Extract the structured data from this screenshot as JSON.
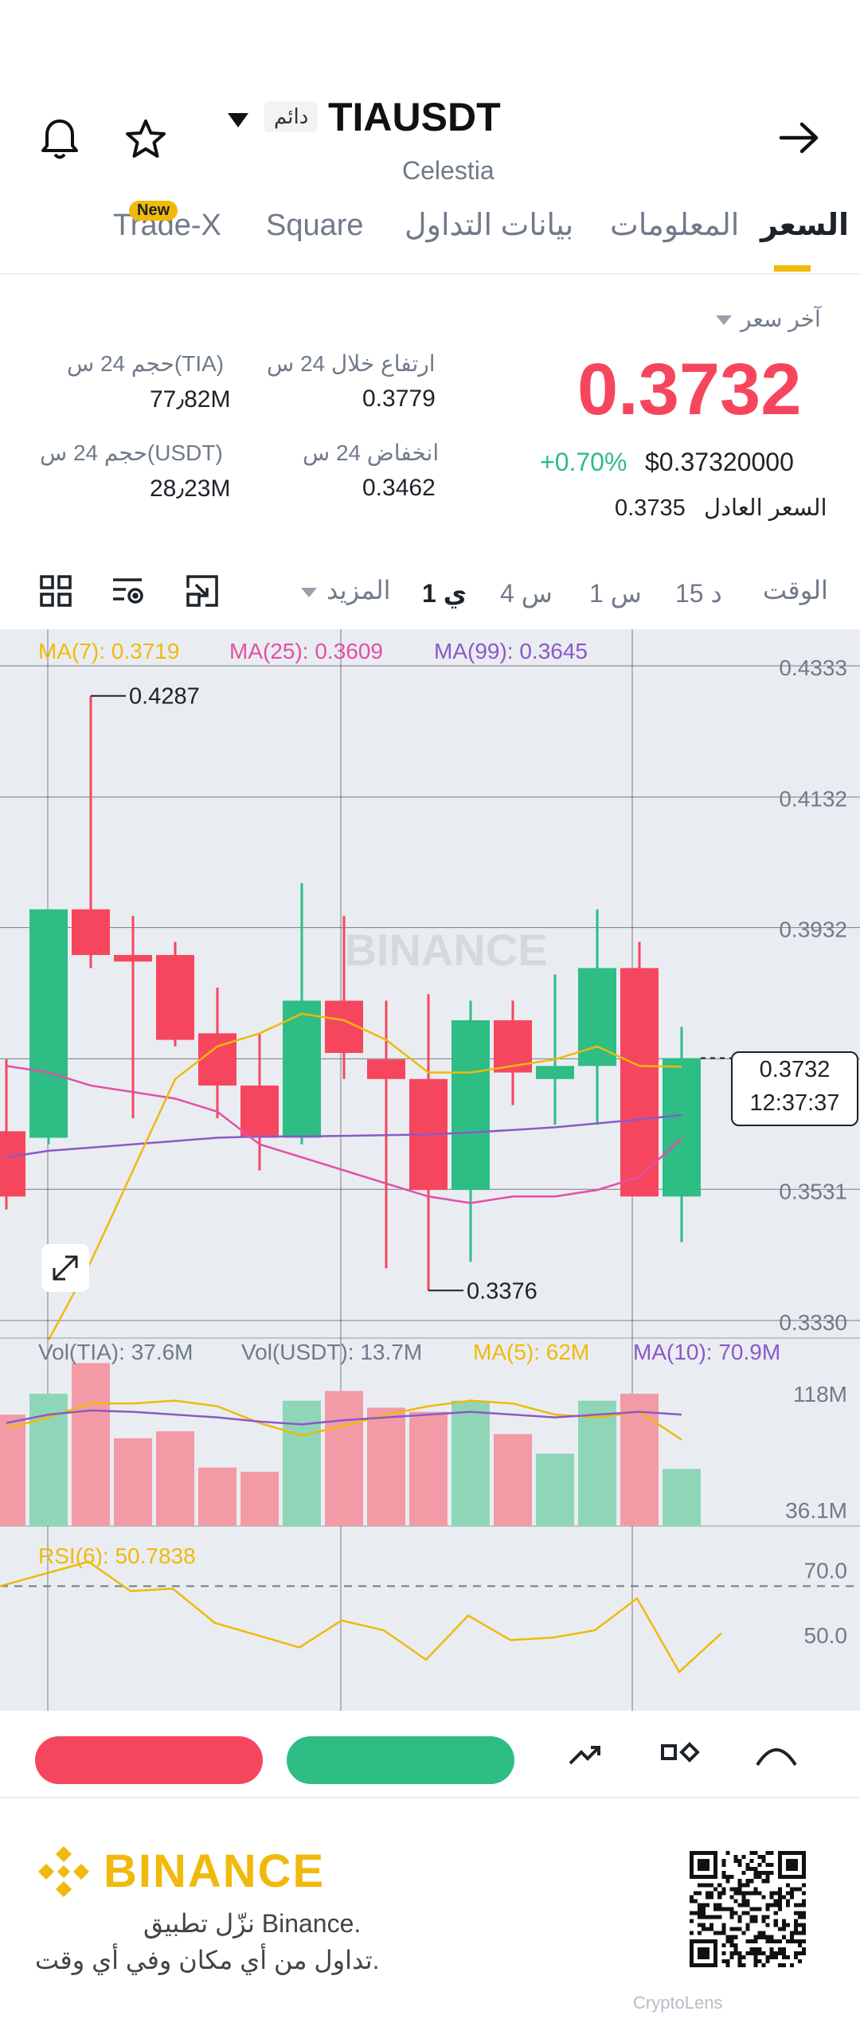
{
  "header": {
    "symbol": "TIAUSDT",
    "perpetual_badge": "دائم",
    "name": "Celestia"
  },
  "tabs": [
    {
      "label": "السعر",
      "active": true
    },
    {
      "label": "المعلومات"
    },
    {
      "label": "بيانات التداول"
    },
    {
      "label": "Square"
    },
    {
      "label": "Trade-X",
      "badge": "New"
    }
  ],
  "price": {
    "type_label": "آخر سعر",
    "last": "0.3732",
    "change": "+0.70%",
    "usd": "$0.37320000",
    "fair_label": "السعر العادل",
    "fair_value": "0.3735"
  },
  "stats": {
    "high_label": "ارتفاع خلال 24 س",
    "high_value": "0.3779",
    "low_label": "انخفاض 24 س",
    "low_value": "0.3462",
    "vol_tia_label": "حجم 24 س(TIA)",
    "vol_tia_value": "77٫82M",
    "vol_usdt_label": "حجم 24 س(USDT)",
    "vol_usdt_value": "28٫23M"
  },
  "timeframes": {
    "time_label": "الوقت",
    "items": [
      "15 د",
      "1 س",
      "4 س",
      "1 ي"
    ],
    "active": "1 ي",
    "more": "المزيد"
  },
  "indicators": {
    "ma7": "MA(7): 0.3719",
    "ma25": "MA(25): 0.3609",
    "ma99": "MA(99): 0.3645",
    "vol_tia": "Vol(TIA): 37.6M",
    "vol_usdt": "Vol(USDT): 13.7M",
    "ma5": "MA(5): 62M",
    "ma10": "MA(10): 70.9M",
    "rsi": "RSI(6): 50.7838"
  },
  "chart_data": {
    "type": "candlestick",
    "price_axis": [
      "0.4333",
      "0.4132",
      "0.3932",
      "0.3731",
      "0.3531",
      "0.3330"
    ],
    "price_ylim": [
      0.333,
      0.4333
    ],
    "high_annotation": "0.4287",
    "low_annotation": "0.3376",
    "current_price": "0.3732",
    "countdown": "12:37:37",
    "candles": [
      {
        "o": 0.362,
        "h": 0.373,
        "l": 0.35,
        "c": 0.352
      },
      {
        "o": 0.361,
        "h": 0.396,
        "l": 0.36,
        "c": 0.396
      },
      {
        "o": 0.396,
        "h": 0.4287,
        "l": 0.387,
        "c": 0.389
      },
      {
        "o": 0.389,
        "h": 0.395,
        "l": 0.364,
        "c": 0.388
      },
      {
        "o": 0.389,
        "h": 0.391,
        "l": 0.375,
        "c": 0.376
      },
      {
        "o": 0.377,
        "h": 0.384,
        "l": 0.364,
        "c": 0.369
      },
      {
        "o": 0.369,
        "h": 0.377,
        "l": 0.356,
        "c": 0.361
      },
      {
        "o": 0.361,
        "h": 0.4,
        "l": 0.36,
        "c": 0.382
      },
      {
        "o": 0.382,
        "h": 0.395,
        "l": 0.37,
        "c": 0.374
      },
      {
        "o": 0.373,
        "h": 0.382,
        "l": 0.341,
        "c": 0.37
      },
      {
        "o": 0.37,
        "h": 0.383,
        "l": 0.3376,
        "c": 0.353
      },
      {
        "o": 0.353,
        "h": 0.382,
        "l": 0.342,
        "c": 0.379
      },
      {
        "o": 0.379,
        "h": 0.382,
        "l": 0.366,
        "c": 0.371
      },
      {
        "o": 0.37,
        "h": 0.386,
        "l": 0.363,
        "c": 0.372
      },
      {
        "o": 0.372,
        "h": 0.396,
        "l": 0.363,
        "c": 0.387
      },
      {
        "o": 0.387,
        "h": 0.391,
        "l": 0.352,
        "c": 0.352
      },
      {
        "o": 0.352,
        "h": 0.378,
        "l": 0.345,
        "c": 0.3732
      }
    ],
    "ma7": [
      null,
      0.33,
      0.342,
      0.356,
      0.37,
      0.375,
      0.377,
      0.38,
      0.379,
      0.376,
      0.371,
      0.371,
      0.372,
      0.373,
      0.375,
      0.372,
      0.3719
    ],
    "ma25": [
      0.372,
      0.371,
      0.369,
      0.368,
      0.367,
      0.365,
      0.36,
      0.358,
      0.356,
      0.354,
      0.352,
      0.351,
      0.352,
      0.352,
      0.353,
      0.355,
      0.3609
    ],
    "ma99": [
      0.358,
      0.359,
      0.3595,
      0.36,
      0.3605,
      0.361,
      0.3612,
      0.3612,
      0.3613,
      0.3614,
      0.3615,
      0.3618,
      0.3622,
      0.3626,
      0.3632,
      0.3638,
      0.3645
    ],
    "volume_axis": [
      "118M",
      "36.1M"
    ],
    "volume_ylim": [
      0,
      135
    ],
    "volume": [
      80,
      95,
      117,
      63,
      68,
      42,
      39,
      90,
      97,
      85,
      82,
      90,
      66,
      52,
      90,
      95,
      41
    ],
    "vol_ma5": [
      70,
      78,
      88,
      88,
      90,
      86,
      74,
      65,
      72,
      80,
      86,
      90,
      88,
      80,
      78,
      82,
      62
    ],
    "vol_ma10": [
      74,
      80,
      83,
      82,
      80,
      78,
      75,
      73,
      76,
      78,
      80,
      82,
      80,
      78,
      80,
      82,
      80
    ],
    "rsi_axis": [
      "70.0",
      "50.0"
    ],
    "rsi_ylim": [
      25,
      90
    ],
    "rsi": [
      null,
      80,
      68,
      69,
      55,
      50,
      45,
      56,
      52,
      40,
      58,
      48,
      49,
      52,
      65,
      35,
      50.78
    ]
  },
  "bottom_bar": {
    "buttons": [
      "sell-button",
      "buy-button"
    ]
  },
  "promo": {
    "brand": "BINANCE",
    "line1": "نزّل تطبيق Binance.",
    "line2": "تداول من أي مكان وفي أي وقت.",
    "watermark": "CryptoLens"
  },
  "colors": {
    "up": "#2ebd85",
    "down": "#f6465d",
    "ma7": "#f0b90b",
    "ma25": "#e44fa6",
    "ma99": "#8c59c6",
    "brand": "#f0b90b"
  }
}
